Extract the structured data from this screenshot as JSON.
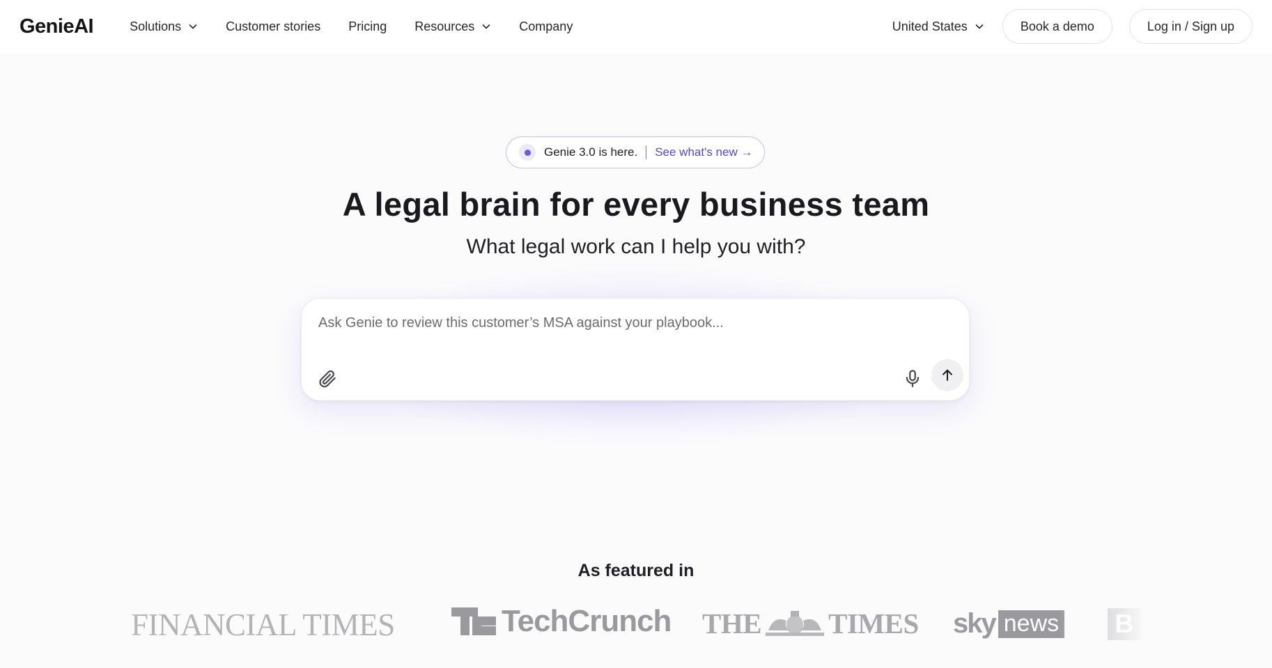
{
  "header": {
    "logo": "GenieAI",
    "nav": [
      {
        "label": "Solutions",
        "dropdown": true
      },
      {
        "label": "Customer stories",
        "dropdown": false
      },
      {
        "label": "Pricing",
        "dropdown": false
      },
      {
        "label": "Resources",
        "dropdown": true
      },
      {
        "label": "Company",
        "dropdown": false
      }
    ],
    "country": "United States",
    "book_demo": "Book a demo",
    "login": "Log in / Sign up"
  },
  "hero": {
    "badge_text": "Genie 3.0 is here.",
    "badge_link": "See what's new →",
    "headline": "A legal brain for every business team",
    "subhead": "What legal work can I help you with?",
    "prompt_placeholder": "Ask Genie to review this customer’s MSA against your playbook...",
    "prompt_value": ""
  },
  "featured": {
    "title": "As featured in",
    "logos": {
      "ft": "FINANCIAL TIMES",
      "techcrunch": "TechCrunch",
      "times_left": "THE",
      "times_right": "TIMES",
      "sky": "sky",
      "news": "news",
      "bbc": [
        "B",
        "B"
      ]
    }
  },
  "colors": {
    "accent": "#5646c6",
    "badge_border": "#c8c0ee",
    "logo_gray": "#a9a9ad"
  },
  "icons": [
    "chevron-down-icon",
    "paperclip-icon",
    "microphone-icon",
    "arrow-up-icon",
    "techcrunch-mark-icon",
    "times-crest-icon"
  ]
}
